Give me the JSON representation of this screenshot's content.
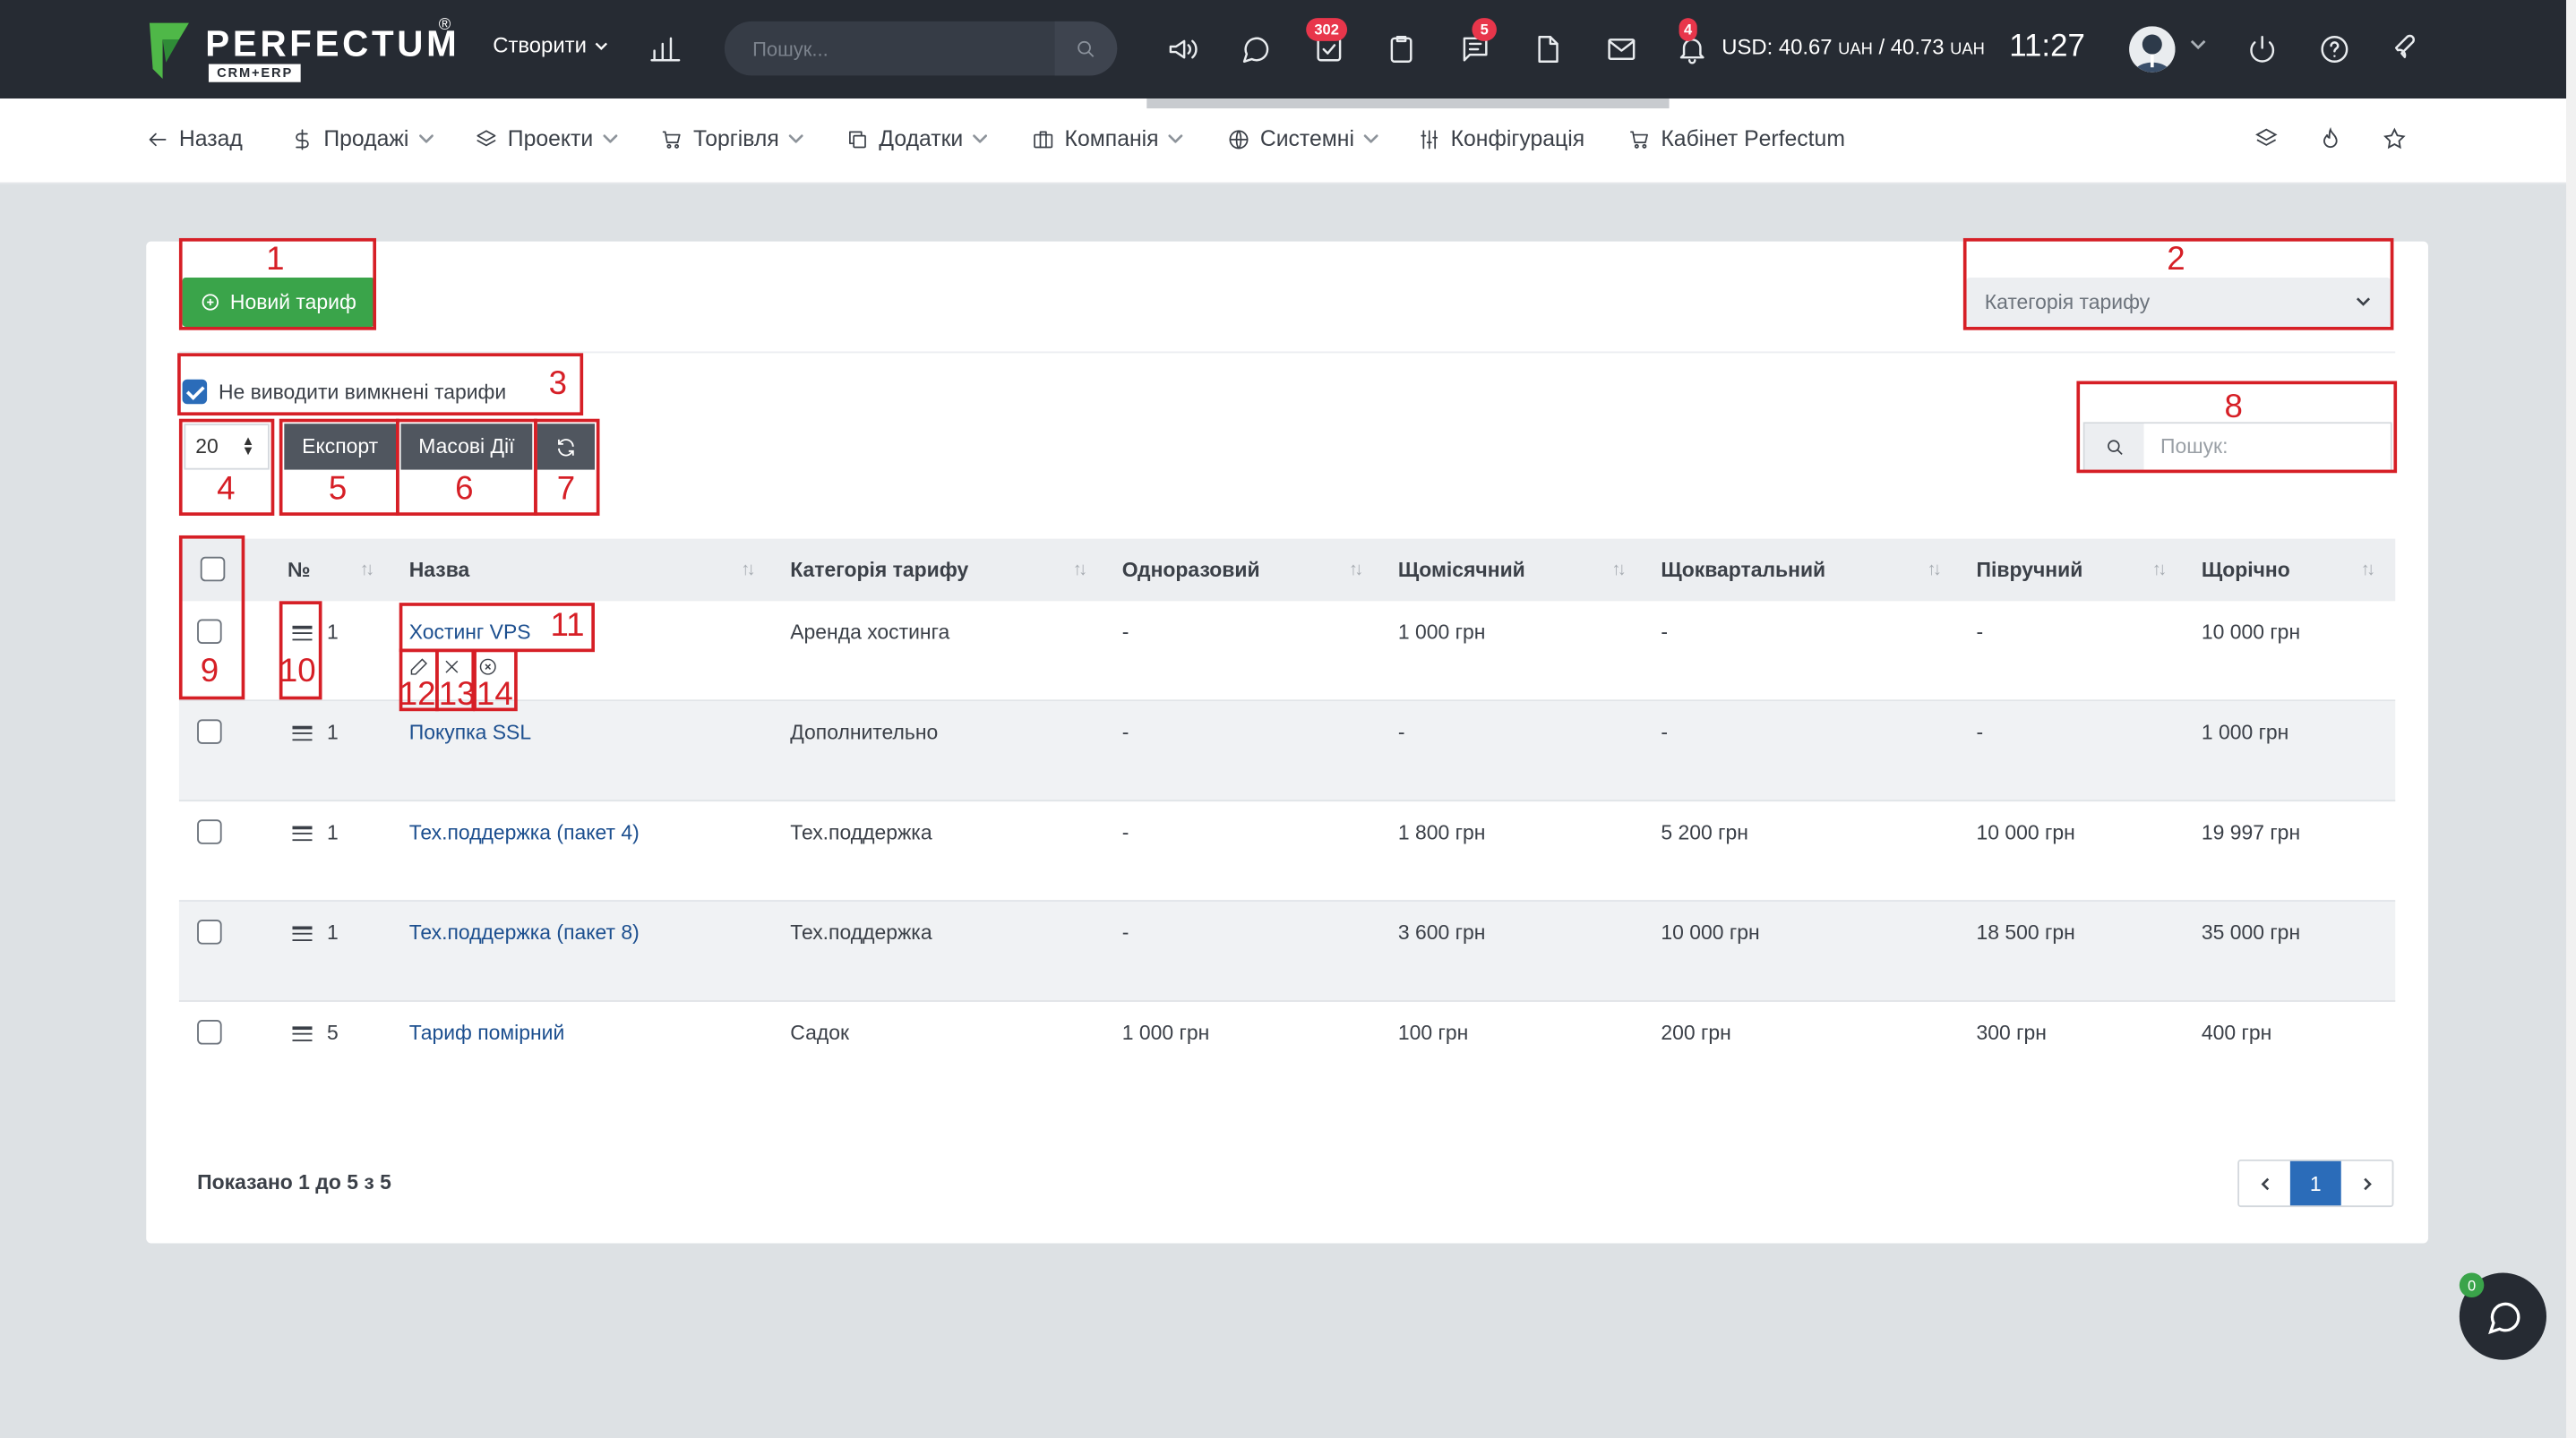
{
  "topbar": {
    "logo_text": "PERFECTUM",
    "logo_reg": "®",
    "logo_sub": "CRM+ERP",
    "create_label": "Створити",
    "search_placeholder": "Пошук...",
    "tasks_badge": "302",
    "messages_badge": "5",
    "notifications_badge": "4",
    "currency_prefix": "USD: 40.67",
    "currency_unit1": "UAH",
    "currency_sep": " / 40.73",
    "currency_unit2": "UAH",
    "clock": "11:27"
  },
  "nav": {
    "back": "Назад",
    "sales": "Продажі",
    "projects": "Проекти",
    "trade": "Торгівля",
    "addons": "Додатки",
    "company": "Компанія",
    "system": "Системні",
    "config": "Конфігурація",
    "cabinet": "Кабінет Perfectum"
  },
  "toolbar": {
    "new_tariff": "Новий тариф",
    "category_placeholder": "Категорія тарифу",
    "hide_disabled": "Не виводити вимкнені тарифи",
    "per_page": "20",
    "export": "Експорт",
    "bulk_actions": "Масові Дії",
    "search_placeholder": "Пошук:"
  },
  "table": {
    "headers": {
      "num": "№",
      "name": "Назва",
      "category": "Категорія тарифу",
      "onetime": "Одноразовий",
      "monthly": "Щомісячний",
      "quarterly": "Щоквартальний",
      "halfyear": "Півручний",
      "yearly": "Щорічно"
    },
    "rows": [
      {
        "num": "1",
        "name": "Хостинг VPS",
        "category": "Аренда хостинга",
        "onetime": "-",
        "monthly": "1 000 грн",
        "quarterly": "-",
        "halfyear": "-",
        "yearly": "10 000 грн"
      },
      {
        "num": "1",
        "name": "Покупка SSL",
        "category": "Дополнительно",
        "onetime": "-",
        "monthly": "-",
        "quarterly": "-",
        "halfyear": "-",
        "yearly": "1 000 грн"
      },
      {
        "num": "1",
        "name": "Тех.поддержка (пакет 4)",
        "category": "Тех.поддержка",
        "onetime": "-",
        "monthly": "1 800 грн",
        "quarterly": "5 200 грн",
        "halfyear": "10 000 грн",
        "yearly": "19 997 грн"
      },
      {
        "num": "1",
        "name": "Тех.поддержка (пакет 8)",
        "category": "Тех.поддержка",
        "onetime": "-",
        "monthly": "3 600 грн",
        "quarterly": "10 000 грн",
        "halfyear": "18 500 грн",
        "yearly": "35 000 грн"
      },
      {
        "num": "5",
        "name": "Тариф помірний",
        "category": "Садок",
        "onetime": "1 000 грн",
        "monthly": "100 грн",
        "quarterly": "200 грн",
        "halfyear": "300 грн",
        "yearly": "400 грн"
      }
    ]
  },
  "footer": {
    "shown": "Показано 1 до 5 з 5",
    "current_page": "1"
  },
  "chat_badge": "0",
  "annotations": [
    "1",
    "2",
    "3",
    "4",
    "5",
    "6",
    "7",
    "8",
    "9",
    "10",
    "11",
    "12",
    "13",
    "14"
  ],
  "colors": {
    "brand_green": "#3aa44a",
    "topbar": "#262b33",
    "annotation_red": "#d61f26",
    "primary_blue": "#2b6cb9"
  }
}
